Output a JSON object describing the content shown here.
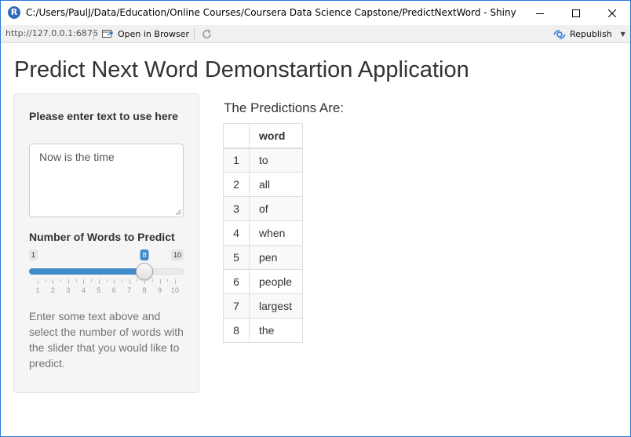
{
  "window": {
    "app_icon_letter": "R",
    "title": "C:/Users/PaulJ/Data/Education/Online Courses/Coursera Data Science Capstone/PredictNextWord - Shiny"
  },
  "toolbar": {
    "url": "http://127.0.0.1:6876",
    "open_in_browser_label": "Open in Browser",
    "republish_label": "Republish"
  },
  "page": {
    "title": "Predict Next Word Demonstartion Application"
  },
  "sidebar": {
    "text_label": "Please enter text to use here",
    "text_value": "Now is the time",
    "slider_label": "Number of Words to Predict",
    "slider": {
      "min": 1,
      "max": 10,
      "value": 8,
      "min_text": "1",
      "max_text": "10",
      "value_text": "8",
      "ticks": [
        "1",
        "2",
        "3",
        "4",
        "5",
        "6",
        "7",
        "8",
        "9",
        "10"
      ]
    },
    "help_text": "Enter some text above and select the number of words with the slider that you would like to predict."
  },
  "predictions": {
    "heading": "The Predictions Are:",
    "column_index": "",
    "column_word": "word",
    "rows": [
      {
        "index": "1",
        "word": "to"
      },
      {
        "index": "2",
        "word": "all"
      },
      {
        "index": "3",
        "word": "of"
      },
      {
        "index": "4",
        "word": "when"
      },
      {
        "index": "5",
        "word": "pen"
      },
      {
        "index": "6",
        "word": "people"
      },
      {
        "index": "7",
        "word": "largest"
      },
      {
        "index": "8",
        "word": "the"
      }
    ]
  },
  "colors": {
    "accent": "#428bca",
    "window_border": "#2b79d7"
  }
}
